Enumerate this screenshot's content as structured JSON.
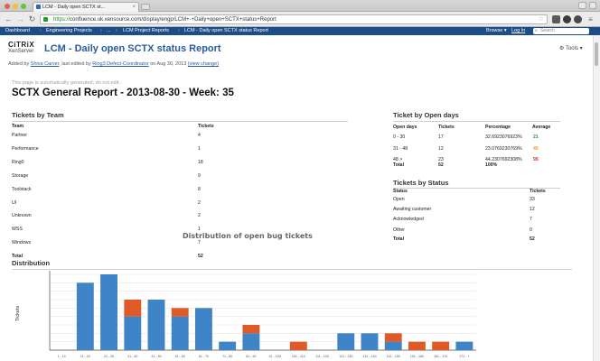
{
  "browser": {
    "tab_title": "LCM - Daily open SCTX st...",
    "url_scheme": "https://",
    "url_rest": "confluence.uk.xensource.com/display/engp/LCM+-+Daily+open+SCTX+status+Report"
  },
  "confluence_bar": {
    "breadcrumbs": [
      "Dashboard",
      "Engineering Projects",
      "...",
      "LCM Project Reports",
      "LCM - Daily open SCTX status Report"
    ],
    "browse_label": "Browse ▾",
    "login_label": "Log In",
    "search_placeholder": "Search"
  },
  "page": {
    "logo_line1": "CiTRiX",
    "logo_line2": "XenServer",
    "title": "LCM - Daily open SCTX status Report",
    "tools_label": "Tools ▾",
    "byline_prefix": "Added by",
    "byline_author": "Shiva Carver",
    "byline_mid": ", last edited by",
    "byline_editor": "Ring3 Defect-Coordinator",
    "byline_date": "on Aug 30, 2013",
    "byline_view_change": "(view change)",
    "auto_note": "This page is automatically generated; do not edit.",
    "report_title": "SCTX General Report - 2013-08-30 - Week: 35"
  },
  "tickets_by_team": {
    "title": "Tickets by Team",
    "headers": [
      "Team",
      "Tickets"
    ],
    "rows": [
      [
        "Partner",
        "4"
      ],
      [
        "Performance",
        "1"
      ],
      [
        "Ring0",
        "18"
      ],
      [
        "Storage",
        "9"
      ],
      [
        "Toolstack",
        "8"
      ],
      [
        "UI",
        "2"
      ],
      [
        "Unknown",
        "2"
      ],
      [
        "WSS",
        "1"
      ],
      [
        "Windows",
        "7"
      ]
    ],
    "total_label": "Total",
    "total_value": "52"
  },
  "ticket_by_open_days": {
    "title": "Ticket by Open days",
    "headers": [
      "Open days",
      "Tickets",
      "Percentage",
      "Average"
    ],
    "rows": [
      [
        "0 - 30",
        "17",
        "32.6923076923%",
        "21"
      ],
      [
        "31 - 48",
        "12",
        "23.0769230769%",
        "40"
      ],
      [
        "48 >",
        "23",
        "44.2307692308%",
        "95"
      ]
    ],
    "total_label": "Total",
    "total_tickets": "52",
    "total_percentage": "100%",
    "average_colors": [
      "#2d9a2d",
      "#e8a21b",
      "#d2322d"
    ]
  },
  "tickets_by_status": {
    "title": "Tickets by Status",
    "headers": [
      "Status",
      "Tickets"
    ],
    "rows": [
      [
        "Open",
        "33"
      ],
      [
        "Awaiting customer",
        "12"
      ],
      [
        "Acknowledged",
        "7"
      ],
      [
        "Other",
        "0"
      ]
    ],
    "total_label": "Total",
    "total_value": "52"
  },
  "distribution": {
    "section_title": "Distribution"
  },
  "chart_data": {
    "type": "bar",
    "stacked": true,
    "title": "Distribution of open bug tickets",
    "ylabel": "Tickets",
    "xlabel": "",
    "ylim": [
      0,
      9
    ],
    "categories": [
      "1 - 10",
      "11 - 20",
      "21 - 30",
      "31 - 40",
      "41 - 50",
      "51 - 60",
      "61 - 70",
      "71 - 80",
      "81 - 90",
      "91 - 100",
      "101 - 110",
      "111 - 120",
      "121 - 130",
      "131 - 140",
      "141 - 150",
      "151 - 160",
      "161 - 170",
      "171 - +"
    ],
    "series": [
      {
        "values": [
          0,
          8,
          9,
          4,
          6,
          4,
          5,
          1,
          2,
          0,
          0,
          0,
          2,
          2,
          1,
          0,
          0,
          1
        ],
        "color": "#3f84c6"
      },
      {
        "values": [
          0,
          0,
          0,
          2,
          0,
          1,
          0,
          0,
          1,
          0,
          1,
          0,
          0,
          0,
          1,
          1,
          1,
          0
        ],
        "color": "#df5a26"
      }
    ],
    "grid": true
  }
}
